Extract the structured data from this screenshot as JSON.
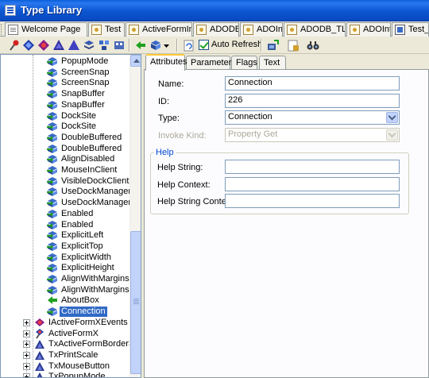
{
  "window": {
    "title": "Type Library"
  },
  "file_tabs": [
    {
      "label": "Welcome Page",
      "icon": "page-icon"
    },
    {
      "label": "Test",
      "icon": "unit-icon"
    },
    {
      "label": "ActiveFormImpl",
      "icon": "unit-icon"
    },
    {
      "label": "ADODB",
      "icon": "unit-icon"
    },
    {
      "label": "ADOInt",
      "icon": "unit-icon"
    },
    {
      "label": "ADODB_TLB",
      "icon": "unit-icon"
    },
    {
      "label": "ADOInt",
      "icon": "unit-icon"
    },
    {
      "label": "Test_TLB.pas",
      "icon": "pascal-file-icon"
    }
  ],
  "toolbar": {
    "auto_refresh_label": "Auto Refresh",
    "auto_refresh_checked": true,
    "buttons": [
      "new-interface-icon",
      "new-dispinterface-icon",
      "new-coclass-icon",
      "new-enum-icon",
      "new-alias-icon",
      "new-record-icon",
      "new-union-icon",
      "new-module-icon",
      "new-method-icon",
      "new-property-icon",
      "refresh-icon",
      "register-icon",
      "export-icon",
      "find-icon"
    ]
  },
  "tree": {
    "items": [
      {
        "label": "PopupMode",
        "kind": "property"
      },
      {
        "label": "ScreenSnap",
        "kind": "property"
      },
      {
        "label": "ScreenSnap",
        "kind": "property"
      },
      {
        "label": "SnapBuffer",
        "kind": "property"
      },
      {
        "label": "SnapBuffer",
        "kind": "property"
      },
      {
        "label": "DockSite",
        "kind": "property"
      },
      {
        "label": "DockSite",
        "kind": "property"
      },
      {
        "label": "DoubleBuffered",
        "kind": "property"
      },
      {
        "label": "DoubleBuffered",
        "kind": "property"
      },
      {
        "label": "AlignDisabled",
        "kind": "property"
      },
      {
        "label": "MouseInClient",
        "kind": "property"
      },
      {
        "label": "VisibleDockClientCoun",
        "kind": "property"
      },
      {
        "label": "UseDockManager",
        "kind": "property"
      },
      {
        "label": "UseDockManager",
        "kind": "property"
      },
      {
        "label": "Enabled",
        "kind": "property"
      },
      {
        "label": "Enabled",
        "kind": "property"
      },
      {
        "label": "ExplicitLeft",
        "kind": "property"
      },
      {
        "label": "ExplicitTop",
        "kind": "property"
      },
      {
        "label": "ExplicitWidth",
        "kind": "property"
      },
      {
        "label": "ExplicitHeight",
        "kind": "property"
      },
      {
        "label": "AlignWithMargins",
        "kind": "property"
      },
      {
        "label": "AlignWithMargins",
        "kind": "property"
      },
      {
        "label": "AboutBox",
        "kind": "method"
      },
      {
        "label": "Connection",
        "kind": "property",
        "selected": true
      },
      {
        "label": "IActiveFormXEvents",
        "kind": "dispinterface"
      },
      {
        "label": "ActiveFormX",
        "kind": "coclass"
      },
      {
        "label": "TxActiveFormBorderStyle",
        "kind": "enum"
      },
      {
        "label": "TxPrintScale",
        "kind": "enum"
      },
      {
        "label": "TxMouseButton",
        "kind": "enum"
      },
      {
        "label": "TxPopupMode",
        "kind": "enum"
      }
    ]
  },
  "page_tabs": [
    {
      "label": "Attributes",
      "active": true
    },
    {
      "label": "Parameters",
      "active": false
    },
    {
      "label": "Flags",
      "active": false
    },
    {
      "label": "Text",
      "active": false
    }
  ],
  "attributes": {
    "name_label": "Name:",
    "name_value": "Connection",
    "id_label": "ID:",
    "id_value": "226",
    "type_label": "Type:",
    "type_value": "Connection",
    "invoke_kind_label": "Invoke Kind:",
    "invoke_kind_value": "Property Get",
    "help_group_title": "Help",
    "help_string_label": "Help String:",
    "help_string_value": "",
    "help_context_label": "Help Context:",
    "help_context_value": "",
    "help_string_context_label": "Help String Context:",
    "help_string_context_value": ""
  },
  "colors": {
    "selection": "#316ac5",
    "titlebar": "#0a5fd8",
    "active_tab_accent": "#ffc83c"
  }
}
